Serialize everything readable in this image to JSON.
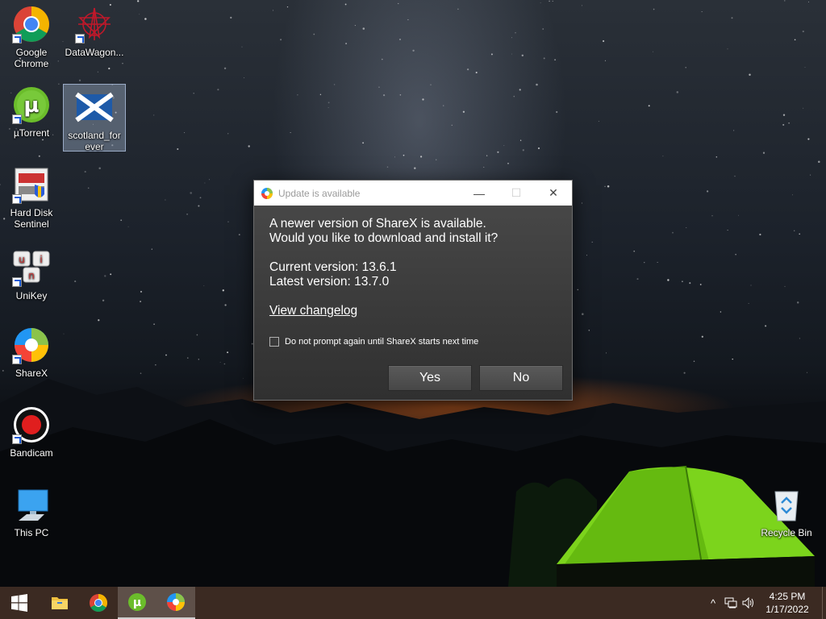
{
  "desktop": {
    "icons": [
      {
        "label": "Google Chrome",
        "icon": "chrome-icon"
      },
      {
        "label": "DataWagon...",
        "icon": "datawagon-icon"
      },
      {
        "label": "µTorrent",
        "icon": "utorrent-icon"
      },
      {
        "label": "scotland_forever",
        "icon": "scotland-flag-icon"
      },
      {
        "label": "Hard Disk Sentinel",
        "icon": "hard-disk-sentinel-icon"
      },
      {
        "label": "UniKey",
        "icon": "unikey-icon"
      },
      {
        "label": "ShareX",
        "icon": "sharex-icon"
      },
      {
        "label": "Bandicam",
        "icon": "bandicam-icon"
      },
      {
        "label": "This PC",
        "icon": "this-pc-icon"
      },
      {
        "label": "Recycle Bin",
        "icon": "recycle-bin-icon"
      }
    ]
  },
  "dialog": {
    "title": "Update is available",
    "line1": "A newer version of ShareX is available.",
    "line2": "Would you like to download and install it?",
    "current_version": "Current version: 13.6.1",
    "latest_version": "Latest version: 13.7.0",
    "changelog_link": "View changelog",
    "checkbox_label": "Do not prompt again until ShareX starts next time",
    "checkbox_checked": false,
    "yes_label": "Yes",
    "no_label": "No",
    "minimize_glyph": "—",
    "maximize_glyph": "☐",
    "close_glyph": "✕"
  },
  "taskbar": {
    "time": "4:25 PM",
    "date": "1/17/2022",
    "pinned": [
      "start-icon",
      "file-explorer-icon",
      "chrome-icon",
      "utorrent-icon",
      "sharex-icon"
    ],
    "tray": [
      "chevron-up-icon",
      "network-icon",
      "volume-icon"
    ],
    "tray_chevron": "^",
    "background_color": "#3b2a22"
  }
}
